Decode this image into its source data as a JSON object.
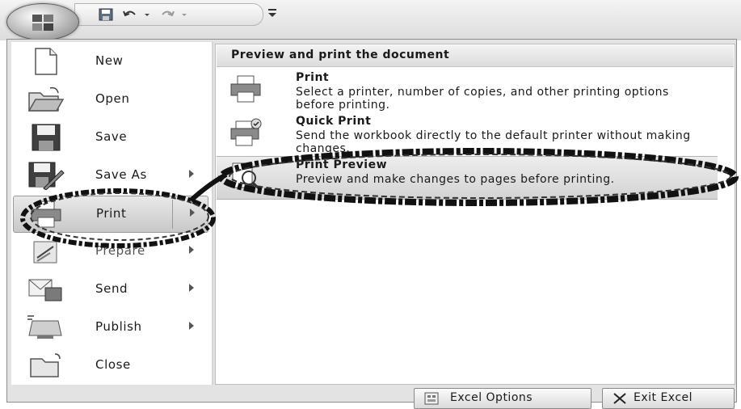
{
  "quick_access": {
    "office_button_icon": "office-logo-icon",
    "icons": [
      "save-icon",
      "undo-icon",
      "undo-dropdown-icon",
      "redo-icon",
      "redo-dropdown-icon",
      "customize-qat-icon"
    ]
  },
  "menu": {
    "commands": [
      {
        "label": "New",
        "icon": "new-document-icon",
        "has_submenu": false
      },
      {
        "label": "Open",
        "icon": "open-folder-icon",
        "has_submenu": false
      },
      {
        "label": "Save",
        "icon": "save-disk-icon",
        "has_submenu": false
      },
      {
        "label": "Save As",
        "icon": "save-as-icon",
        "has_submenu": true
      },
      {
        "label": "Print",
        "icon": "printer-icon",
        "has_submenu": true,
        "active": true
      },
      {
        "label": "Prepare",
        "icon": "prepare-icon",
        "has_submenu": true
      },
      {
        "label": "Send",
        "icon": "send-icon",
        "has_submenu": true
      },
      {
        "label": "Publish",
        "icon": "publish-icon",
        "has_submenu": true
      },
      {
        "label": "Close",
        "icon": "close-folder-icon",
        "has_submenu": false
      }
    ]
  },
  "submenu": {
    "header": "Preview and print the document",
    "options": [
      {
        "title": "Print",
        "description": "Select a printer, number of copies, and other printing options before printing.",
        "icon": "printer-icon"
      },
      {
        "title": "Quick Print",
        "description": "Send the workbook directly to the default printer without making changes.",
        "icon": "quick-print-icon"
      },
      {
        "title": "Print Preview",
        "description": "Preview and make changes to pages before printing.",
        "icon": "print-preview-icon",
        "highlighted": true
      }
    ]
  },
  "footer": {
    "excel_options_label": "Excel Options",
    "exit_excel_label": "Exit Excel"
  }
}
